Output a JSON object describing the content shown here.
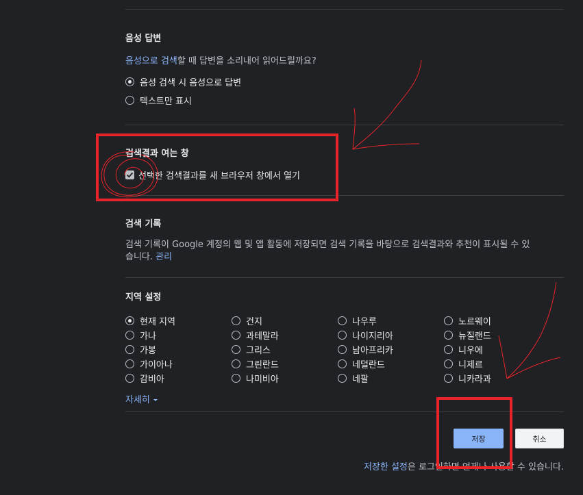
{
  "voice": {
    "title": "음성 답변",
    "question_link": "음성으로 검색",
    "question_rest": "할 때 답변을 소리내어 읽어드릴까요?",
    "options": [
      {
        "label": "음성 검색 시 음성으로 답변",
        "selected": true
      },
      {
        "label": "텍스트만 표시",
        "selected": false
      }
    ]
  },
  "results_window": {
    "title": "검색결과 여는 창",
    "checkbox_label": "선택한 검색결과를 새 브라우저 창에서 열기",
    "checked": true
  },
  "history": {
    "title": "검색 기록",
    "desc_line1": "검색 기록이 Google 계정의 웹 및 앱 활동에 저장되면 검색 기록을 바탕으로 검색결과와 추천이 표시될 수 있",
    "desc_line2": "습니다.",
    "manage_link": "관리"
  },
  "region": {
    "title": "지역 설정",
    "columns": [
      [
        "현재 지역",
        "가나",
        "가봉",
        "가이아나",
        "감비아"
      ],
      [
        "건지",
        "과테말라",
        "그리스",
        "그린란드",
        "나미비아"
      ],
      [
        "나우루",
        "나이지리아",
        "남아프리카",
        "네덜란드",
        "네팔"
      ],
      [
        "노르웨이",
        "뉴질랜드",
        "니우에",
        "니제르",
        "니카라과"
      ]
    ],
    "selected": "현재 지역",
    "more_link": "자세히",
    "more_icon": "caret-down-icon"
  },
  "buttons": {
    "save": "저장",
    "cancel": "취소"
  },
  "footer": {
    "link": "저장한 설정",
    "rest": "은 로그인하면 언제나 사용할 수 있습니다."
  },
  "colors": {
    "background": "#202124",
    "link": "#8ab4f8",
    "annotation_red": "#e8242a"
  }
}
